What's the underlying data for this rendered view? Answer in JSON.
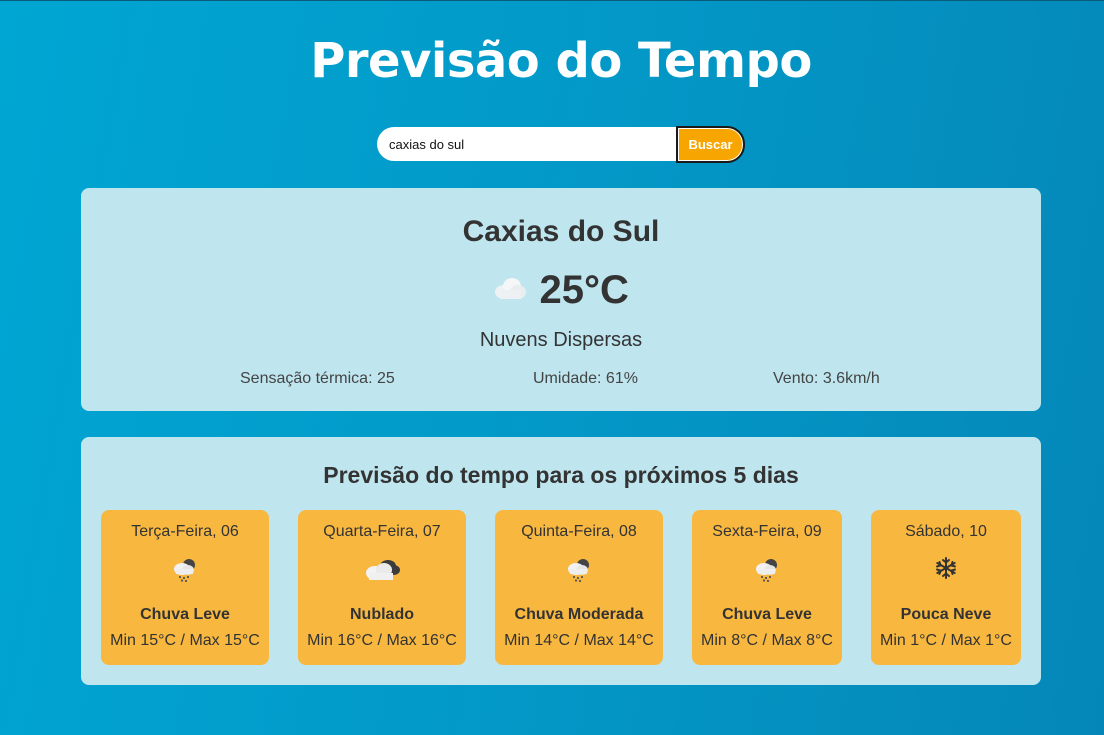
{
  "app": {
    "title": "Previsão do Tempo"
  },
  "search": {
    "value": "caxias do sul",
    "button_label": "Buscar"
  },
  "current": {
    "city": "Caxias do Sul",
    "icon": "cloud-icon",
    "temperature": "25°C",
    "description": "Nuvens Dispersas",
    "feels_like": "Sensação térmica: 25",
    "humidity": "Umidade: 61%",
    "wind": "Vento: 3.6km/h"
  },
  "forecast": {
    "title": "Previsão do tempo para os próximos 5 dias",
    "days": [
      {
        "day": "Terça-Feira, 06",
        "icon": "rain-cloud-icon",
        "condition": "Chuva Leve",
        "range": "Min 15°C / Max 15°C"
      },
      {
        "day": "Quarta-Feira, 07",
        "icon": "clouds-icon",
        "condition": "Nublado",
        "range": "Min 16°C / Max 16°C"
      },
      {
        "day": "Quinta-Feira, 08",
        "icon": "rain-cloud-icon",
        "condition": "Chuva Moderada",
        "range": "Min 14°C / Max 14°C"
      },
      {
        "day": "Sexta-Feira, 09",
        "icon": "rain-cloud-icon",
        "condition": "Chuva Leve",
        "range": "Min 8°C / Max 8°C"
      },
      {
        "day": "Sábado, 10",
        "icon": "snowflake-icon",
        "condition": "Pouca Neve",
        "range": "Min 1°C / Max 1°C"
      }
    ]
  },
  "colors": {
    "accent": "#f7a500",
    "card": "#bfe5ef",
    "day_card": "#f8b73f"
  }
}
